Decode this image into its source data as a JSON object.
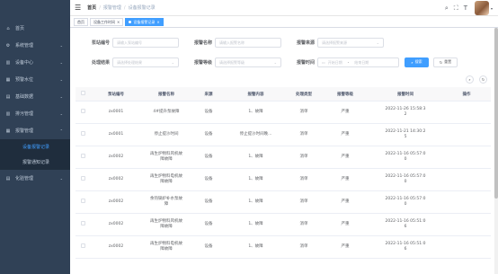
{
  "sidebar": {
    "items": [
      {
        "label": "首页",
        "icon": "home-icon",
        "glyph": "⌂",
        "arrow": ""
      },
      {
        "label": "系统管理",
        "icon": "gear-icon",
        "glyph": "⚙",
        "arrow": "⌄"
      },
      {
        "label": "设备中心",
        "icon": "chart-icon",
        "glyph": "▥",
        "arrow": "⌄"
      },
      {
        "label": "预警水位",
        "icon": "chart-icon",
        "glyph": "▦",
        "arrow": "⌄"
      },
      {
        "label": "基础数据",
        "icon": "chart-icon",
        "glyph": "▤",
        "arrow": "⌄"
      },
      {
        "label": "排污管理",
        "icon": "chart-icon",
        "glyph": "▥",
        "arrow": "⌄"
      },
      {
        "label": "报警管理",
        "icon": "chart-icon",
        "glyph": "▦",
        "arrow": "⌃"
      }
    ],
    "submenu": [
      {
        "label": "设备报警记录",
        "active": true
      },
      {
        "label": "报警通知记录",
        "active": false
      }
    ],
    "last_item": {
      "label": "化验管理",
      "icon": "chart-icon",
      "glyph": "▤",
      "arrow": "⌄"
    }
  },
  "header": {
    "breadcrumb": [
      "首页",
      "报警管理",
      "设备报警记录"
    ],
    "icons": [
      "search-icon",
      "fullscreen-icon",
      "font-size-icon"
    ]
  },
  "tags": [
    {
      "label": "首页",
      "active": false
    },
    {
      "label": "设备工作时间",
      "close": "×",
      "active": false
    },
    {
      "label": "设备报警记录",
      "close": "×",
      "active": true
    }
  ],
  "form": {
    "equipment_no_label": "泵站编号",
    "equipment_no_placeholder": "请输入泵站编号",
    "alarm_name_label": "报警名称",
    "alarm_name_placeholder": "请输入报警名称",
    "source_label": "报警来源",
    "source_placeholder": "请选择报警来源",
    "result_label": "处理结果",
    "result_placeholder": "请选择处理结果",
    "level_label": "报警等级",
    "level_placeholder": "请选择报警等级",
    "time_label": "报警时间",
    "time_start": "开始日期",
    "time_sep": "-",
    "time_end": "结束日期",
    "search_button": "搜索",
    "reset_button": "重置"
  },
  "table": {
    "columns": [
      "",
      "泵站编号",
      "报警名称",
      "来源",
      "报警内容",
      "处理类型",
      "报警等级",
      "报警时间",
      "操作"
    ],
    "rows": [
      {
        "no": "zx0001",
        "name": "4#提升泵故障",
        "source": "设备",
        "content": "1、故障",
        "type": "消单",
        "level": "严重",
        "time": "2022-11-26 15:58:3\n2"
      },
      {
        "no": "zx0001",
        "name": "停止提沙时间",
        "source": "设备",
        "content": "停止提沙时间晚...",
        "type": "消单",
        "level": "严重",
        "time": "2022-11-21 14:30:2\n5"
      },
      {
        "no": "zx0002",
        "name": "再生炉物料风机故\n障故障",
        "source": "设备",
        "content": "1、故障",
        "type": "消单",
        "level": "严重",
        "time": "2022-11-16 05:57:0\n0"
      },
      {
        "no": "zx0002",
        "name": "再生炉物料电机故\n障故障",
        "source": "设备",
        "content": "1、故障",
        "type": "消单",
        "level": "严重",
        "time": "2022-11-16 05:57:0\n0"
      },
      {
        "no": "zx0002",
        "name": "余热锅炉补水泵故\n障",
        "source": "设备",
        "content": "1、故障",
        "type": "消单",
        "level": "严重",
        "time": "2022-11-16 05:57:0\n0"
      },
      {
        "no": "zx0002",
        "name": "再生炉物料风机故\n障故障",
        "source": "设备",
        "content": "1、故障",
        "type": "消单",
        "level": "严重",
        "time": "2022-11-16 05:51:0\n6"
      },
      {
        "no": "zx0002",
        "name": "再生炉物料电机故\n障故障",
        "source": "设备",
        "content": "1、故障",
        "type": "消单",
        "level": "严重",
        "time": "2022-11-16 05:51:0\n6"
      }
    ]
  },
  "colors": {
    "sidebar_bg": "#304156",
    "submenu_bg": "#1f2d3d",
    "accent": "#409eff"
  }
}
